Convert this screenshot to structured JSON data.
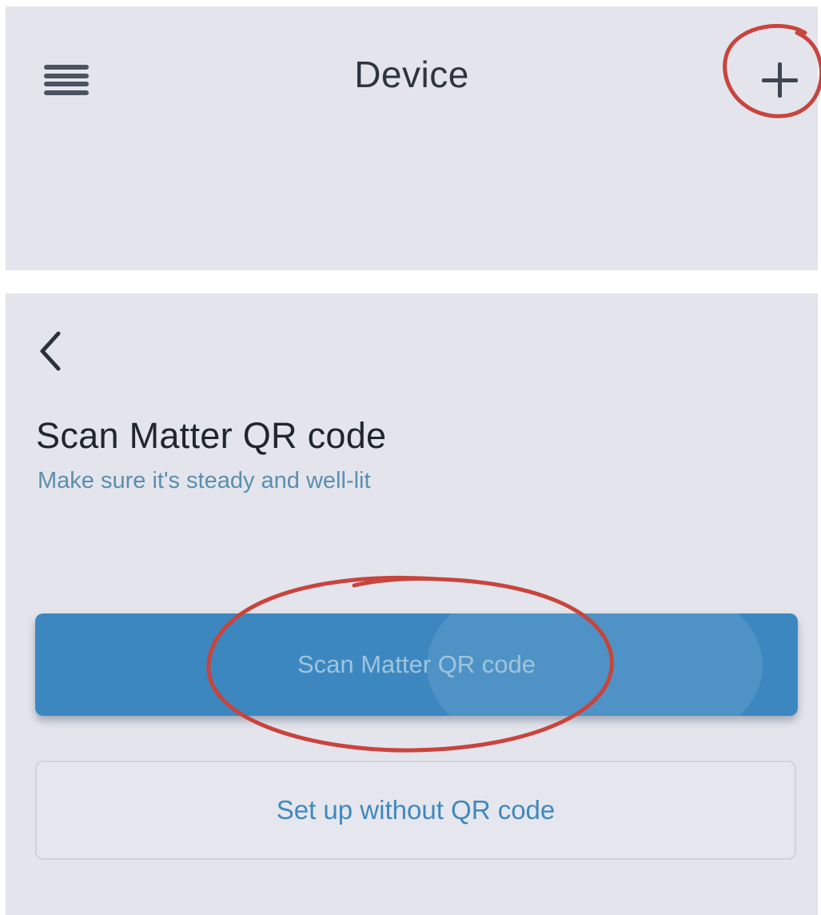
{
  "header": {
    "title": "Device",
    "menu_icon": "hamburger-menu-icon",
    "add_icon": "plus-icon"
  },
  "scan_screen": {
    "back_icon": "chevron-left-icon",
    "title": "Scan Matter QR code",
    "subtitle": "Make sure it's steady and well-lit",
    "primary_button_label": "Scan Matter QR code",
    "secondary_button_label": "Set up without QR code"
  },
  "colors": {
    "panel_background": "#e4e4ec",
    "primary_button": "#3c87c0",
    "primary_button_text": "#9fc4de",
    "secondary_button_text": "#3f88bd",
    "subtitle_text": "#5a8fae",
    "annotation_red": "#c8443c"
  }
}
